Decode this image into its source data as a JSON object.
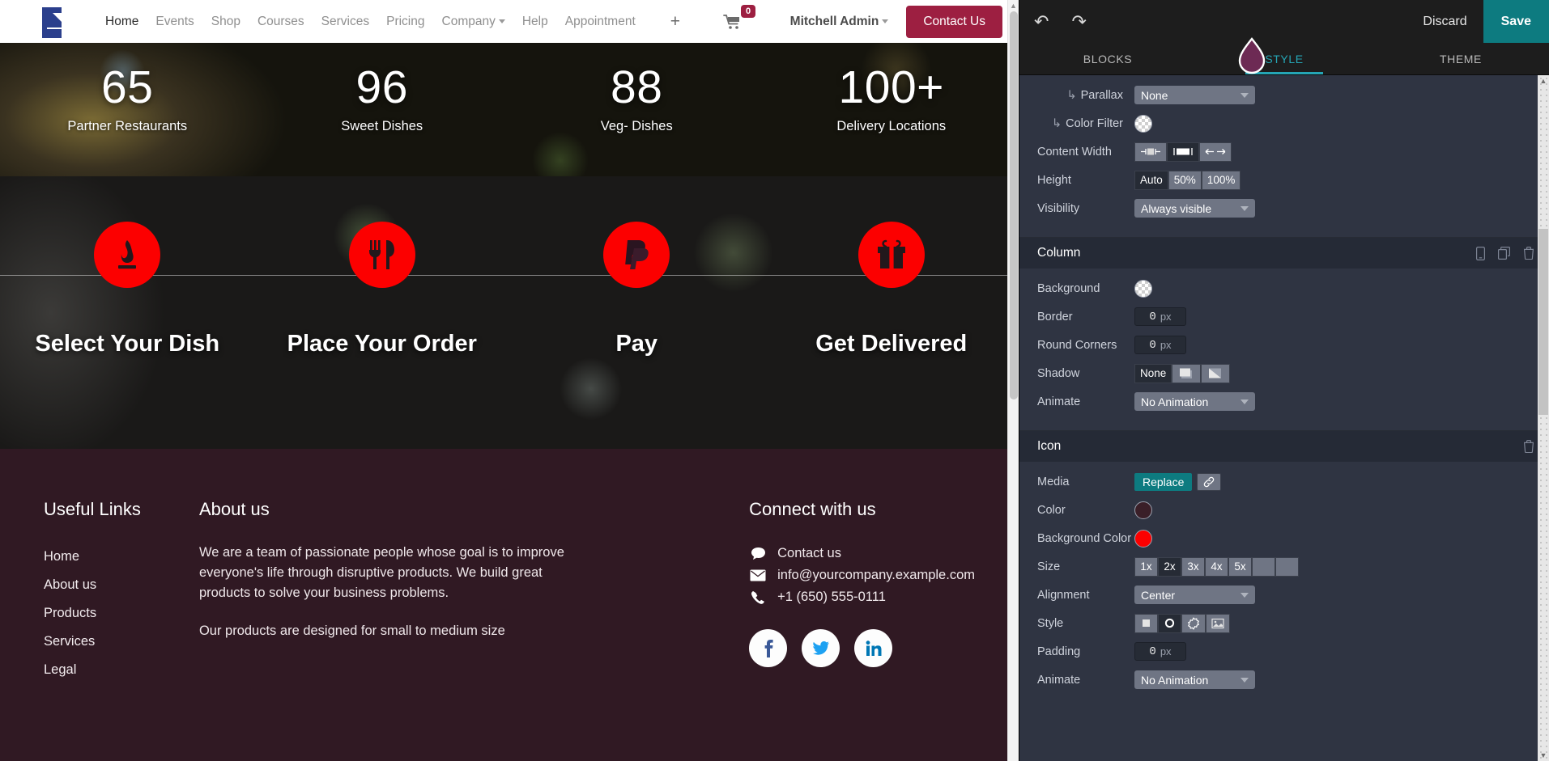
{
  "website": {
    "navbar": {
      "logo_name": "brand-logo",
      "links": [
        {
          "label": "Home",
          "active": true
        },
        {
          "label": "Events",
          "active": false
        },
        {
          "label": "Shop",
          "active": false
        },
        {
          "label": "Courses",
          "active": false
        },
        {
          "label": "Services",
          "active": false
        },
        {
          "label": "Pricing",
          "active": false
        },
        {
          "label": "Company",
          "active": false,
          "dropdown": true
        },
        {
          "label": "Help",
          "active": false
        },
        {
          "label": "Appointment",
          "active": false
        }
      ],
      "plus_label": "+",
      "cart_count": "0",
      "user_name": "Mitchell Admin",
      "contact_button": "Contact Us"
    },
    "counters": [
      {
        "number": "65",
        "label": "Partner Restaurants"
      },
      {
        "number": "96",
        "label": "Sweet Dishes"
      },
      {
        "number": "88",
        "label": "Veg- Dishes"
      },
      {
        "number": "100+",
        "label": "Delivery Locations"
      }
    ],
    "steps": [
      {
        "title": "Select Your Dish",
        "icon": "hot-dish-icon"
      },
      {
        "title": "Place Your Order",
        "icon": "fork-knife-icon"
      },
      {
        "title": "Pay",
        "icon": "paypal-icon"
      },
      {
        "title": "Get Delivered",
        "icon": "gift-icon"
      }
    ],
    "footer": {
      "useful_links_title": "Useful Links",
      "useful_links": [
        "Home",
        "About us",
        "Products",
        "Services",
        "Legal"
      ],
      "about_title": "About us",
      "about_p1": "We are a team of passionate people whose goal is to improve everyone's life through disruptive products. We build great products to solve your business problems.",
      "about_p2": "Our products are designed for small to medium size",
      "connect_title": "Connect with us",
      "contacts": [
        {
          "icon": "comment-icon",
          "text": "Contact us"
        },
        {
          "icon": "envelope-icon",
          "text": "info@yourcompany.example.com"
        },
        {
          "icon": "phone-icon",
          "text": "+1 (650) 555-0111"
        }
      ],
      "socials": [
        "facebook-icon",
        "twitter-icon",
        "linkedin-icon"
      ]
    }
  },
  "editor": {
    "toolbar": {
      "undo_icon": "undo-icon",
      "redo_icon": "redo-icon",
      "discard_label": "Discard",
      "save_label": "Save"
    },
    "tabs": [
      {
        "label": "BLOCKS",
        "active": false
      },
      {
        "label": "STYLE",
        "active": true
      },
      {
        "label": "THEME",
        "active": false
      }
    ],
    "section_options": [
      {
        "label": "Parallax",
        "indented": true,
        "control": "select",
        "value": "None"
      },
      {
        "label": "Color Filter",
        "indented": true,
        "control": "swatch",
        "value": ""
      },
      {
        "label": "Content Width",
        "control": "buttons",
        "options": [
          "narrow",
          "normal",
          "full"
        ],
        "selected": 1
      },
      {
        "label": "Height",
        "control": "buttons",
        "options": [
          "Auto",
          "50%",
          "100%"
        ],
        "selected": 0
      },
      {
        "label": "Visibility",
        "control": "select",
        "value": "Always visible"
      }
    ],
    "column_group": {
      "title": "Column",
      "header_icons": [
        "mobile-icon",
        "duplicate-icon",
        "trash-icon"
      ],
      "options": [
        {
          "label": "Background",
          "control": "swatch",
          "value": ""
        },
        {
          "label": "Border",
          "control": "number",
          "value": "0",
          "unit": "px"
        },
        {
          "label": "Round Corners",
          "control": "number",
          "value": "0",
          "unit": "px"
        },
        {
          "label": "Shadow",
          "control": "buttons",
          "options": [
            "None",
            "outset",
            "inset"
          ],
          "selected": 0
        },
        {
          "label": "Animate",
          "control": "select",
          "value": "No Animation"
        }
      ]
    },
    "icon_group": {
      "title": "Icon",
      "header_icons": [
        "trash-icon"
      ],
      "media_label": "Media",
      "replace_label": "Replace",
      "link_icon": "link-icon",
      "color_label": "Color",
      "color_value": "#3a1f28",
      "bg_color_label": "Background Color",
      "bg_color_value": "#fc0000",
      "size_label": "Size",
      "size_options": [
        "1x",
        "2x",
        "3x",
        "4x",
        "5x",
        "",
        ""
      ],
      "size_selected": 1,
      "alignment_label": "Alignment",
      "alignment_value": "Center",
      "style_label": "Style",
      "style_options": [
        "square",
        "circle",
        "burst",
        "image"
      ],
      "style_selected": 1,
      "padding_label": "Padding",
      "padding_value": "0",
      "padding_unit": "px",
      "animate_label": "Animate",
      "animate_value": "No Animation"
    }
  },
  "colors": {
    "brand_maroon": "#9d1f41",
    "icon_red": "#fc0000",
    "editor_teal": "#0d7b80",
    "footer_bg": "#301923",
    "panel_bg": "#2f3442"
  }
}
